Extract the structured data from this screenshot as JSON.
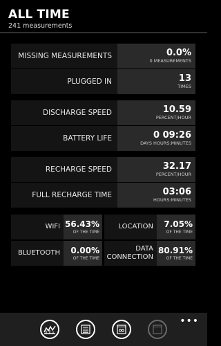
{
  "header": {
    "title": "ALL TIME",
    "subtitle": "241 measurements"
  },
  "groups": [
    [
      {
        "label": "MISSING MEASUREMENTS",
        "value": "0.0%",
        "unit": "0 MEASUREMENTS"
      },
      {
        "label": "PLUGGED IN",
        "value": "13",
        "unit": "TIMES"
      }
    ],
    [
      {
        "label": "DISCHARGE SPEED",
        "value": "10.59",
        "unit": "PERCENT/HOUR"
      },
      {
        "label": "BATTERY LIFE",
        "value": "0 09:26",
        "unit": "DAYS HOURS:MINUTES"
      }
    ],
    [
      {
        "label": "RECHARGE SPEED",
        "value": "32.17",
        "unit": "PERCENT/HOUR"
      },
      {
        "label": "FULL RECHARGE TIME",
        "value": "03:06",
        "unit": "HOURS:MINUTES"
      }
    ]
  ],
  "stats": [
    {
      "label": "WIFI",
      "value": "56.43%",
      "unit": "OF THE TIME"
    },
    {
      "label": "LOCATION",
      "value": "7.05%",
      "unit": "OF THE TIME"
    },
    {
      "label": "BLUETOOTH",
      "value": "0.00%",
      "unit": "OF THE TIME"
    },
    {
      "label": "DATA CONNECTION",
      "value": "80.91%",
      "unit": "OF THE TIME"
    }
  ],
  "appbar": {
    "buttons": [
      "chart-icon",
      "list-icon",
      "infinity-icon",
      "window-icon"
    ],
    "more": "•••"
  }
}
